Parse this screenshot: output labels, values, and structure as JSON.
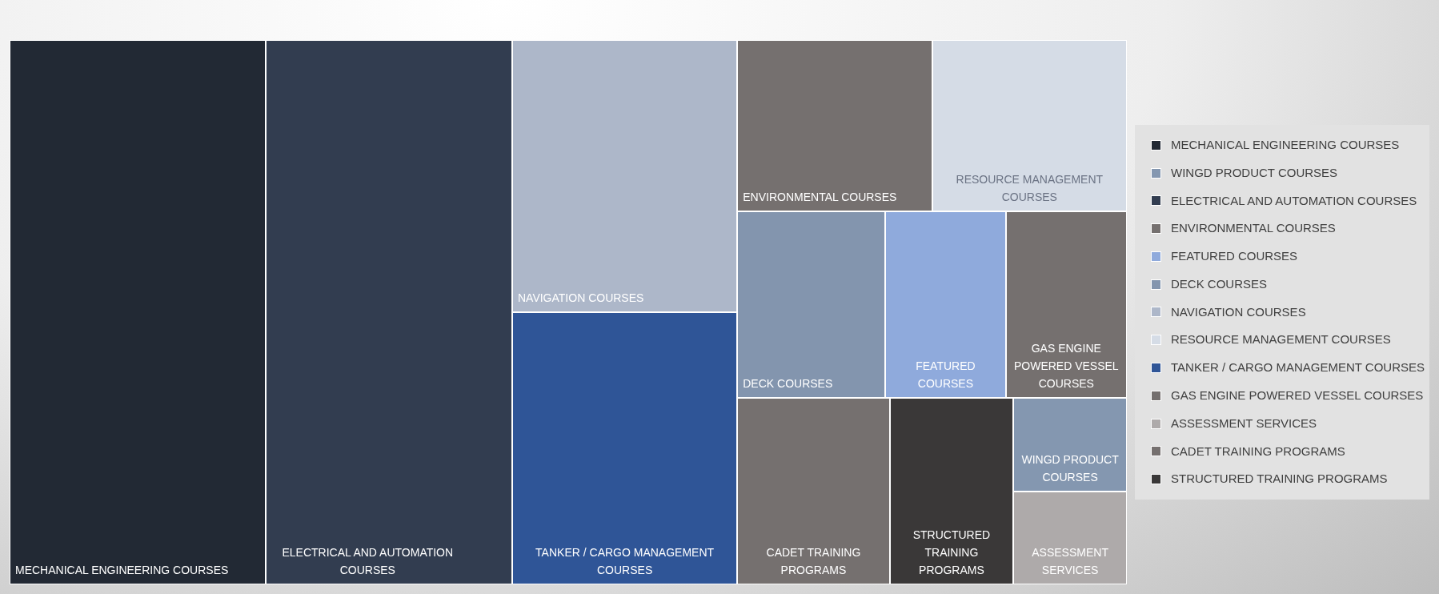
{
  "treemap": {
    "tiles": [
      {
        "label": "MECHANICAL ENGINEERING COURSES",
        "color": "#222934"
      },
      {
        "label": "ELECTRICAL AND AUTOMATION COURSES",
        "color": "#323d50"
      },
      {
        "label": "NAVIGATION COURSES",
        "color": "#adb7c9"
      },
      {
        "label": "TANKER / CARGO MANAGEMENT COURSES",
        "color": "#2f5597"
      },
      {
        "label": "ENVIRONMENTAL COURSES",
        "color": "#75706f"
      },
      {
        "label": "RESOURCE MANAGEMENT COURSES",
        "color": "#d5dce6"
      },
      {
        "label": "DECK COURSES",
        "color": "#8395ae"
      },
      {
        "label": "FEATURED COURSES",
        "color": "#8faadc"
      },
      {
        "label": "GAS ENGINE POWERED VESSEL COURSES",
        "color": "#75706f"
      },
      {
        "label": "CADET TRAINING PROGRAMS",
        "color": "#75706f"
      },
      {
        "label": "STRUCTURED TRAINING PROGRAMS",
        "color": "#3a3838"
      },
      {
        "label": "WINGD PRODUCT COURSES",
        "color": "#8497b0"
      },
      {
        "label": "ASSESSMENT SERVICES",
        "color": "#aeaaaa"
      }
    ]
  },
  "legend": [
    {
      "label": "MECHANICAL ENGINEERING COURSES",
      "color": "#222934"
    },
    {
      "label": "WINGD PRODUCT COURSES",
      "color": "#8497b0"
    },
    {
      "label": "ELECTRICAL AND AUTOMATION COURSES",
      "color": "#323d50"
    },
    {
      "label": "ENVIRONMENTAL COURSES",
      "color": "#75706f"
    },
    {
      "label": "FEATURED COURSES",
      "color": "#8faadc"
    },
    {
      "label": "DECK COURSES",
      "color": "#8395ae"
    },
    {
      "label": "NAVIGATION COURSES",
      "color": "#adb7c9"
    },
    {
      "label": "RESOURCE MANAGEMENT COURSES",
      "color": "#d5dce6"
    },
    {
      "label": "TANKER / CARGO MANAGEMENT COURSES",
      "color": "#2f5597"
    },
    {
      "label": "GAS ENGINE POWERED VESSEL COURSES",
      "color": "#75706f"
    },
    {
      "label": "ASSESSMENT SERVICES",
      "color": "#aeaaaa"
    },
    {
      "label": "CADET TRAINING PROGRAMS",
      "color": "#75706f"
    },
    {
      "label": "STRUCTURED TRAINING PROGRAMS",
      "color": "#3a3838"
    }
  ]
}
